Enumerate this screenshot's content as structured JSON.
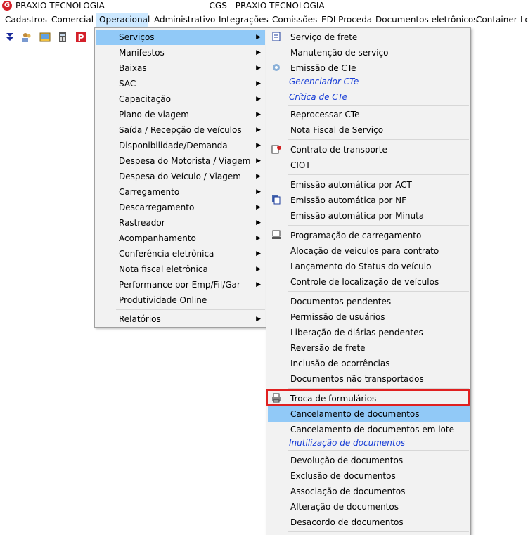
{
  "titlebar": {
    "app_name": "PRAXIO TECNOLOGIA",
    "window_title": "- CGS - PRAXIO TECNOLOGIA",
    "logo_letter": "G"
  },
  "menubar": [
    "Cadastros",
    "Comercial",
    "Operacional",
    "Administrativo",
    "Integrações",
    "Comissões",
    "EDI Proceda",
    "Documentos eletrônicos",
    "Container",
    "Lo"
  ],
  "operacional_menu": [
    "Serviços",
    "Manifestos",
    "Baixas",
    "SAC",
    "Capacitação",
    "Plano de viagem",
    "Saída / Recepção de veículos",
    "Disponibilidade/Demanda",
    "Despesa do Motorista / Viagem",
    "Despesa do Veículo / Viagem",
    "Carregamento",
    "Descarregamento",
    "Rastreador",
    "Acompanhamento",
    "Conferência eletrônica",
    "Nota fiscal eletrônica",
    "Performance por Emp/Fil/Gar",
    "Produtividade Online",
    "Relatórios"
  ],
  "servicos_menu": [
    "Serviço de frete",
    "Manutenção de serviço",
    "Emissão de CTe",
    "Gerenciador CTe",
    "Crítica de CTe",
    "Reprocessar CTe",
    "Nota Fiscal de Serviço",
    "Contrato de transporte",
    "CIOT",
    "Emissão automática por ACT",
    "Emissão automática por NF",
    "Emissão automática por Minuta",
    "Programação de carregamento",
    "Alocação de veículos para contrato",
    "Lançamento do Status do veículo",
    "Controle de localização de veículos",
    "Documentos pendentes",
    "Permissão de usuários",
    "Liberação de diárias pendentes",
    "Reversão de frete",
    "Inclusão de ocorrências",
    "Documentos não transportados",
    "Troca de formulários",
    "Cancelamento de documentos",
    "Cancelamento de documentos em lote",
    "Inutilização de documentos",
    "Devolução de documentos",
    "Exclusão de documentos",
    "Associação de documentos",
    "Alteração de documentos",
    "Desacordo de documentos"
  ],
  "colors": {
    "highlight": "#91c9f7",
    "callout": "#e02020",
    "link": "#1a3fd6"
  },
  "icons": [
    "collapse-icon",
    "users-icon",
    "image-icon",
    "calculator-icon",
    "praxio-p-icon"
  ]
}
